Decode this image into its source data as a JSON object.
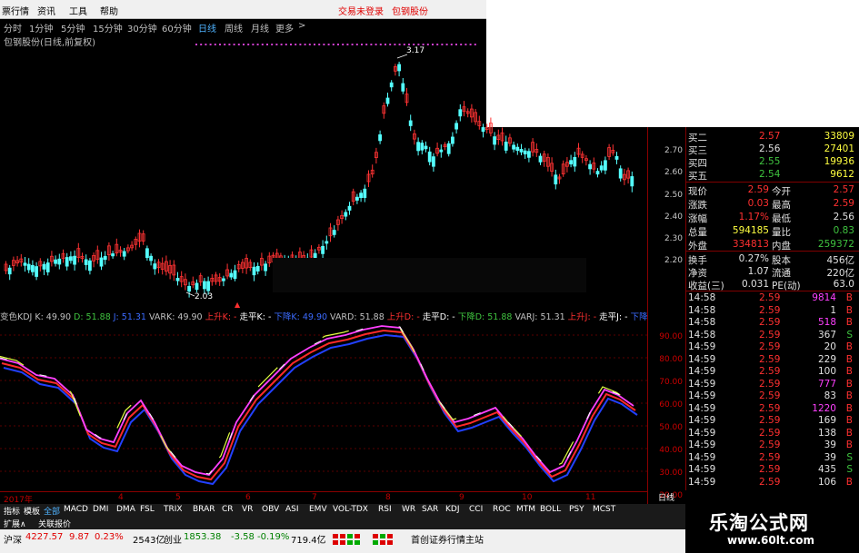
{
  "menu": {
    "items": [
      "票行情",
      "资讯",
      "工具",
      "帮助"
    ],
    "login_status": "交易未登录",
    "stock_name": "包钢股份"
  },
  "periods": [
    "分时",
    "1分钟",
    "5分钟",
    "15分钟",
    "30分钟",
    "60分钟",
    "日线",
    "周线",
    "月线",
    "更多",
    ">"
  ],
  "chart_title": "包钢股份(日线,前复权)",
  "price_axis": [
    "2.70",
    "2.60",
    "2.50",
    "2.40",
    "2.30",
    "2.20"
  ],
  "annotations": {
    "high": "3.17",
    "low": "2.03"
  },
  "kdj_header": [
    {
      "text": "变色KDJ",
      "color": "#c0c0c0"
    },
    {
      "text": "K: 49.90",
      "color": "#c0c0c0"
    },
    {
      "text": "D: 51.88",
      "color": "#3fc33f"
    },
    {
      "text": "J: 51.31",
      "color": "#3b6bff"
    },
    {
      "text": "VARK: 49.90",
      "color": "#c0c0c0"
    },
    {
      "text": "上升K: -",
      "color": "#ff3030"
    },
    {
      "text": "走平K: -",
      "color": "#ffffff"
    },
    {
      "text": "下降K: 49.90",
      "color": "#3b6bff"
    },
    {
      "text": "VARD: 51.88",
      "color": "#c0c0c0"
    },
    {
      "text": "上升D: -",
      "color": "#ff3030"
    },
    {
      "text": "走平D: -",
      "color": "#ffffff"
    },
    {
      "text": "下降D: 51.88",
      "color": "#3fc33f"
    },
    {
      "text": "VARJ: 51.31",
      "color": "#c0c0c0"
    },
    {
      "text": "上升J: -",
      "color": "#ff3030"
    },
    {
      "text": "走平J: -",
      "color": "#ffffff"
    },
    {
      "text": "下降",
      "color": "#3b6bff"
    }
  ],
  "kdj_axis": [
    "90.00",
    "80.00",
    "70.00",
    "60.00",
    "50.00",
    "40.00",
    "30.00",
    "20.00"
  ],
  "buy_levels": [
    {
      "label": "买二",
      "price": "2.57",
      "vol": "33809",
      "pcolor": "#ff3030"
    },
    {
      "label": "买三",
      "price": "2.56",
      "vol": "27401",
      "pcolor": "#e0e0e0"
    },
    {
      "label": "买四",
      "price": "2.55",
      "vol": "19936",
      "pcolor": "#3fc33f"
    },
    {
      "label": "买五",
      "price": "2.54",
      "vol": "9612",
      "pcolor": "#3fc33f"
    }
  ],
  "stats": [
    {
      "l1": "现价",
      "v1": "2.59",
      "c1": "#ff3030",
      "l2": "今开",
      "v2": "2.57",
      "c2": "#ff3030"
    },
    {
      "l1": "涨跌",
      "v1": "0.03",
      "c1": "#ff3030",
      "l2": "最高",
      "v2": "2.59",
      "c2": "#ff3030"
    },
    {
      "l1": "涨幅",
      "v1": "1.17%",
      "c1": "#ff3030",
      "l2": "最低",
      "v2": "2.56",
      "c2": "#e0e0e0"
    },
    {
      "l1": "总量",
      "v1": "594185",
      "c1": "#ffff40",
      "l2": "量比",
      "v2": "0.83",
      "c2": "#3fc33f"
    },
    {
      "l1": "外盘",
      "v1": "334813",
      "c1": "#ff3030",
      "l2": "内盘",
      "v2": "259372",
      "c2": "#3fc33f"
    }
  ],
  "stats2": [
    {
      "l1": "换手",
      "v1": "0.27%",
      "l2": "股本",
      "v2": "456亿"
    },
    {
      "l1": "净资",
      "v1": "1.07",
      "l2": "流通",
      "v2": "220亿"
    },
    {
      "l1": "收益(三)",
      "v1": "0.031",
      "l2": "PE(动)",
      "v2": "63.0"
    }
  ],
  "ticks": [
    {
      "t": "14:58",
      "p": "2.59",
      "v": "9814",
      "s": "B",
      "vc": "#ff40ff"
    },
    {
      "t": "14:58",
      "p": "2.59",
      "v": "1",
      "s": "B",
      "vc": "#e0e0e0"
    },
    {
      "t": "14:58",
      "p": "2.59",
      "v": "518",
      "s": "B",
      "vc": "#ff40ff"
    },
    {
      "t": "14:58",
      "p": "2.59",
      "v": "367",
      "s": "S",
      "vc": "#e0e0e0"
    },
    {
      "t": "14:59",
      "p": "2.59",
      "v": "20",
      "s": "B",
      "vc": "#e0e0e0"
    },
    {
      "t": "14:59",
      "p": "2.59",
      "v": "229",
      "s": "B",
      "vc": "#e0e0e0"
    },
    {
      "t": "14:59",
      "p": "2.59",
      "v": "100",
      "s": "B",
      "vc": "#e0e0e0"
    },
    {
      "t": "14:59",
      "p": "2.59",
      "v": "777",
      "s": "B",
      "vc": "#ff40ff"
    },
    {
      "t": "14:59",
      "p": "2.59",
      "v": "83",
      "s": "B",
      "vc": "#e0e0e0"
    },
    {
      "t": "14:59",
      "p": "2.59",
      "v": "1220",
      "s": "B",
      "vc": "#ff40ff"
    },
    {
      "t": "14:59",
      "p": "2.59",
      "v": "169",
      "s": "B",
      "vc": "#e0e0e0"
    },
    {
      "t": "14:59",
      "p": "2.59",
      "v": "138",
      "s": "B",
      "vc": "#e0e0e0"
    },
    {
      "t": "14:59",
      "p": "2.59",
      "v": "39",
      "s": "B",
      "vc": "#e0e0e0"
    },
    {
      "t": "14:59",
      "p": "2.59",
      "v": "39",
      "s": "S",
      "vc": "#e0e0e0"
    },
    {
      "t": "14:59",
      "p": "2.59",
      "v": "435",
      "s": "S",
      "vc": "#e0e0e0"
    },
    {
      "t": "14:59",
      "p": "2.59",
      "v": "106",
      "s": "B",
      "vc": "#e0e0e0"
    }
  ],
  "date_axis": [
    "2017年",
    "4",
    "5",
    "6",
    "7",
    "8",
    "9",
    "10",
    "11"
  ],
  "day_button": "日线",
  "indicator_tabs": [
    "指标",
    "模板",
    "全部",
    "MACD",
    "DMI",
    "DMA",
    "FSL",
    "TRIX",
    "BRAR",
    "CR",
    "VR",
    "OBV",
    "ASI",
    "EMV",
    "VOL-TDX",
    "RSI",
    "WR",
    "SAR",
    "KDJ",
    "CCI",
    "ROC",
    "MTM",
    "BOLL",
    "PSY",
    "MCST"
  ],
  "tabs2": [
    "扩展∧",
    "关联报价"
  ],
  "status": {
    "sh_label": "沪深",
    "sh_value": "4227.57",
    "sh_change": "9.87",
    "sh_pct": "0.23%",
    "sh_amount": "2543亿",
    "cy_label": "创业",
    "cy_value": "1853.38",
    "cy_change": "-3.58",
    "cy_pct": "-0.19%",
    "cy_amount": "719.4亿",
    "site": "首创证券行情主站"
  },
  "watermark": {
    "title": "乐淘公式网",
    "url": "www.60lt.com"
  }
}
